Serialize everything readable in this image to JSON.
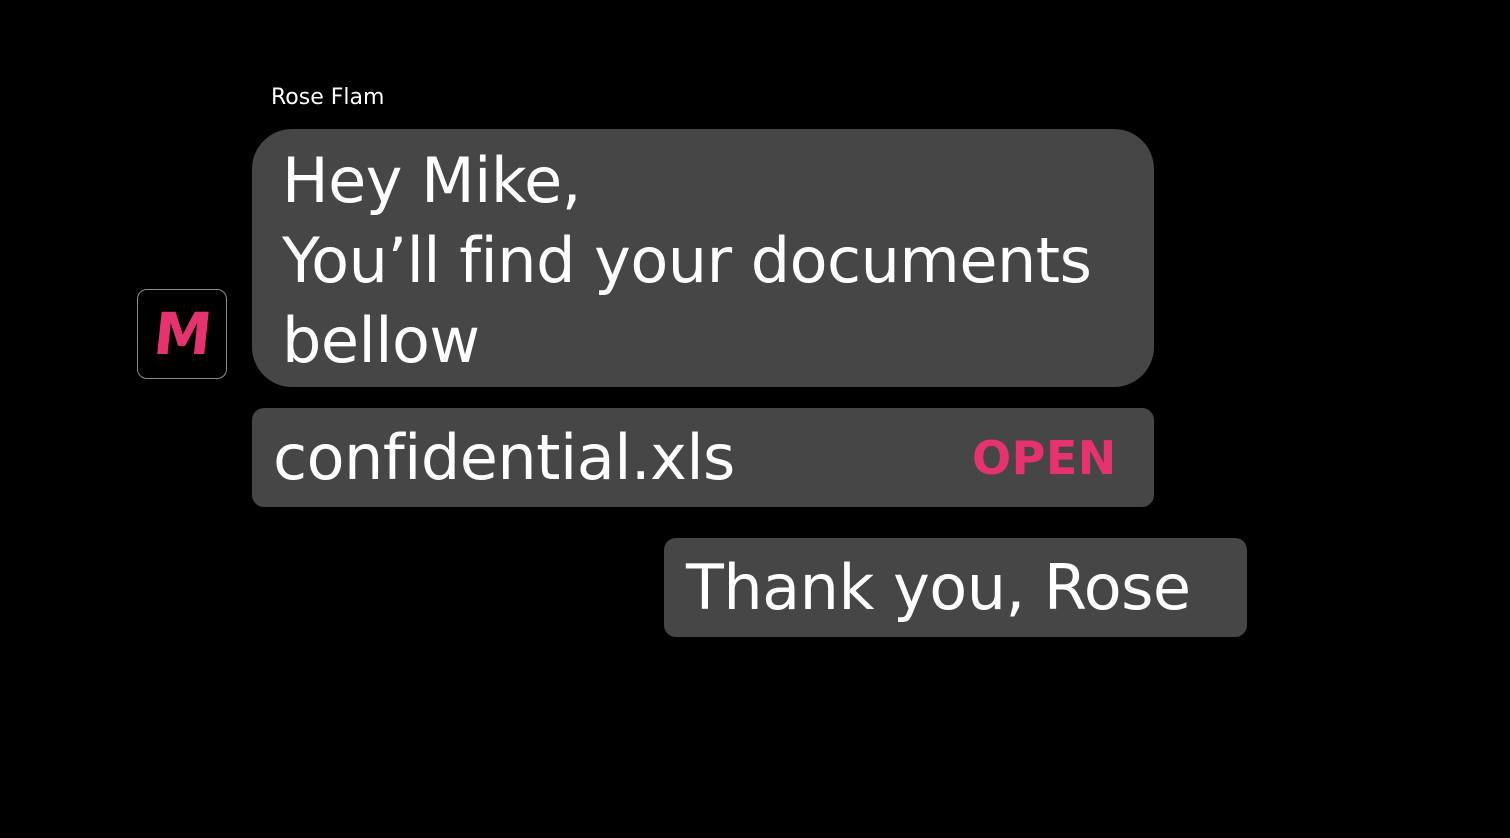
{
  "colors": {
    "background": "#000000",
    "bubble": "#464646",
    "accent": "#e6336f",
    "text": "#ffffff",
    "avatar_border": "#8a8a8a"
  },
  "message": {
    "sender_name": "Rose Flam",
    "avatar_letter": "M",
    "lines": [
      "Hey Mike,",
      "You’ll find your documents",
      "bellow"
    ]
  },
  "attachment": {
    "file_name": "confidential.xls",
    "open_label": "OPEN"
  },
  "reply": {
    "text": "Thank you, Rose"
  }
}
